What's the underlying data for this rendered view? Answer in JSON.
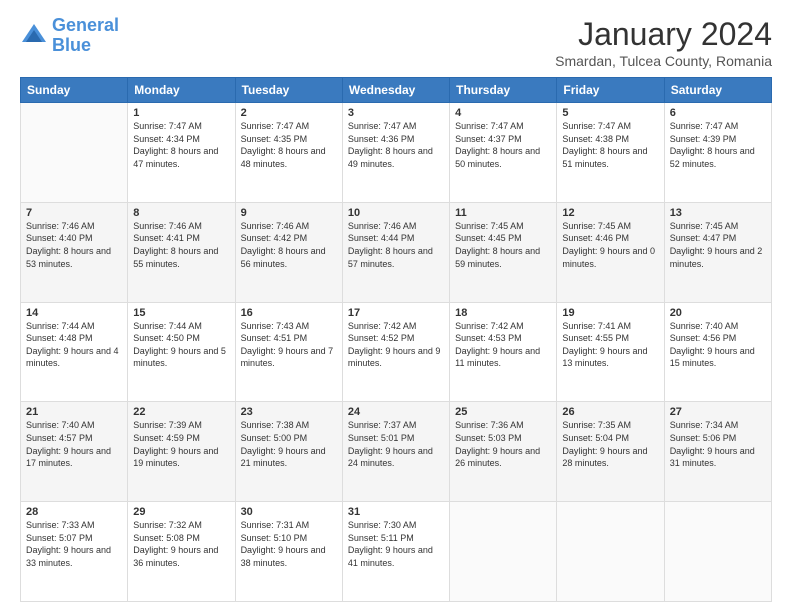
{
  "header": {
    "logo_line1": "General",
    "logo_line2": "Blue",
    "month": "January 2024",
    "location": "Smardan, Tulcea County, Romania"
  },
  "weekdays": [
    "Sunday",
    "Monday",
    "Tuesday",
    "Wednesday",
    "Thursday",
    "Friday",
    "Saturday"
  ],
  "weeks": [
    [
      {
        "day": "",
        "info": ""
      },
      {
        "day": "1",
        "info": "Sunrise: 7:47 AM\nSunset: 4:34 PM\nDaylight: 8 hours and 47 minutes."
      },
      {
        "day": "2",
        "info": "Sunrise: 7:47 AM\nSunset: 4:35 PM\nDaylight: 8 hours and 48 minutes."
      },
      {
        "day": "3",
        "info": "Sunrise: 7:47 AM\nSunset: 4:36 PM\nDaylight: 8 hours and 49 minutes."
      },
      {
        "day": "4",
        "info": "Sunrise: 7:47 AM\nSunset: 4:37 PM\nDaylight: 8 hours and 50 minutes."
      },
      {
        "day": "5",
        "info": "Sunrise: 7:47 AM\nSunset: 4:38 PM\nDaylight: 8 hours and 51 minutes."
      },
      {
        "day": "6",
        "info": "Sunrise: 7:47 AM\nSunset: 4:39 PM\nDaylight: 8 hours and 52 minutes."
      }
    ],
    [
      {
        "day": "7",
        "info": "Sunrise: 7:46 AM\nSunset: 4:40 PM\nDaylight: 8 hours and 53 minutes."
      },
      {
        "day": "8",
        "info": "Sunrise: 7:46 AM\nSunset: 4:41 PM\nDaylight: 8 hours and 55 minutes."
      },
      {
        "day": "9",
        "info": "Sunrise: 7:46 AM\nSunset: 4:42 PM\nDaylight: 8 hours and 56 minutes."
      },
      {
        "day": "10",
        "info": "Sunrise: 7:46 AM\nSunset: 4:44 PM\nDaylight: 8 hours and 57 minutes."
      },
      {
        "day": "11",
        "info": "Sunrise: 7:45 AM\nSunset: 4:45 PM\nDaylight: 8 hours and 59 minutes."
      },
      {
        "day": "12",
        "info": "Sunrise: 7:45 AM\nSunset: 4:46 PM\nDaylight: 9 hours and 0 minutes."
      },
      {
        "day": "13",
        "info": "Sunrise: 7:45 AM\nSunset: 4:47 PM\nDaylight: 9 hours and 2 minutes."
      }
    ],
    [
      {
        "day": "14",
        "info": "Sunrise: 7:44 AM\nSunset: 4:48 PM\nDaylight: 9 hours and 4 minutes."
      },
      {
        "day": "15",
        "info": "Sunrise: 7:44 AM\nSunset: 4:50 PM\nDaylight: 9 hours and 5 minutes."
      },
      {
        "day": "16",
        "info": "Sunrise: 7:43 AM\nSunset: 4:51 PM\nDaylight: 9 hours and 7 minutes."
      },
      {
        "day": "17",
        "info": "Sunrise: 7:42 AM\nSunset: 4:52 PM\nDaylight: 9 hours and 9 minutes."
      },
      {
        "day": "18",
        "info": "Sunrise: 7:42 AM\nSunset: 4:53 PM\nDaylight: 9 hours and 11 minutes."
      },
      {
        "day": "19",
        "info": "Sunrise: 7:41 AM\nSunset: 4:55 PM\nDaylight: 9 hours and 13 minutes."
      },
      {
        "day": "20",
        "info": "Sunrise: 7:40 AM\nSunset: 4:56 PM\nDaylight: 9 hours and 15 minutes."
      }
    ],
    [
      {
        "day": "21",
        "info": "Sunrise: 7:40 AM\nSunset: 4:57 PM\nDaylight: 9 hours and 17 minutes."
      },
      {
        "day": "22",
        "info": "Sunrise: 7:39 AM\nSunset: 4:59 PM\nDaylight: 9 hours and 19 minutes."
      },
      {
        "day": "23",
        "info": "Sunrise: 7:38 AM\nSunset: 5:00 PM\nDaylight: 9 hours and 21 minutes."
      },
      {
        "day": "24",
        "info": "Sunrise: 7:37 AM\nSunset: 5:01 PM\nDaylight: 9 hours and 24 minutes."
      },
      {
        "day": "25",
        "info": "Sunrise: 7:36 AM\nSunset: 5:03 PM\nDaylight: 9 hours and 26 minutes."
      },
      {
        "day": "26",
        "info": "Sunrise: 7:35 AM\nSunset: 5:04 PM\nDaylight: 9 hours and 28 minutes."
      },
      {
        "day": "27",
        "info": "Sunrise: 7:34 AM\nSunset: 5:06 PM\nDaylight: 9 hours and 31 minutes."
      }
    ],
    [
      {
        "day": "28",
        "info": "Sunrise: 7:33 AM\nSunset: 5:07 PM\nDaylight: 9 hours and 33 minutes."
      },
      {
        "day": "29",
        "info": "Sunrise: 7:32 AM\nSunset: 5:08 PM\nDaylight: 9 hours and 36 minutes."
      },
      {
        "day": "30",
        "info": "Sunrise: 7:31 AM\nSunset: 5:10 PM\nDaylight: 9 hours and 38 minutes."
      },
      {
        "day": "31",
        "info": "Sunrise: 7:30 AM\nSunset: 5:11 PM\nDaylight: 9 hours and 41 minutes."
      },
      {
        "day": "",
        "info": ""
      },
      {
        "day": "",
        "info": ""
      },
      {
        "day": "",
        "info": ""
      }
    ]
  ]
}
